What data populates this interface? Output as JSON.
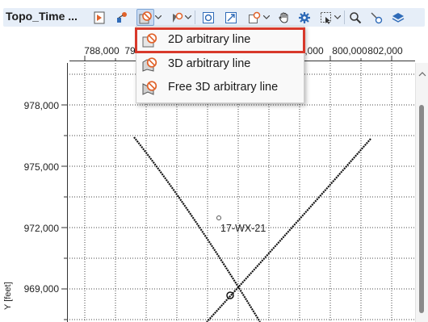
{
  "window": {
    "title": "Topo_Time ..."
  },
  "toolbar": {
    "buttons": [
      {
        "name": "color-bar-icon"
      },
      {
        "name": "well-path-icon"
      },
      {
        "name": "arbitrary-line-icon",
        "pressed": true,
        "dropdown": true
      },
      {
        "name": "pick-tool-icon",
        "dropdown": true
      },
      {
        "name": "zoom-extent-icon"
      },
      {
        "name": "select-region-icon"
      },
      {
        "name": "polygon-tool-icon",
        "dropdown": true
      },
      {
        "name": "hand-pan-icon"
      },
      {
        "name": "settings-gear-icon"
      },
      {
        "name": "selection-box-icon",
        "dropdown": true
      },
      {
        "name": "search-magnifier-icon"
      },
      {
        "name": "picker-tool-icon"
      },
      {
        "name": "layers-icon"
      }
    ]
  },
  "dropdown_menu": {
    "items": [
      {
        "label": "2D arbitrary line",
        "highlighted": true
      },
      {
        "label": "3D arbitrary line"
      },
      {
        "label": "Free 3D arbitrary line"
      }
    ]
  },
  "map": {
    "x_ticks": [
      "788,000",
      "79",
      ",000",
      "800,000",
      "802,000"
    ],
    "y_ticks": [
      "978,000",
      "975,000",
      "972,000",
      "969,000"
    ],
    "y_axis_title": "Y [feet]",
    "well": {
      "label": "17-WX-21"
    }
  },
  "colors": {
    "accent_red": "#d8392b",
    "toolbar_blue": "#e6eef8",
    "icon_orange": "#e0622a",
    "icon_blue": "#2f6bb8"
  }
}
